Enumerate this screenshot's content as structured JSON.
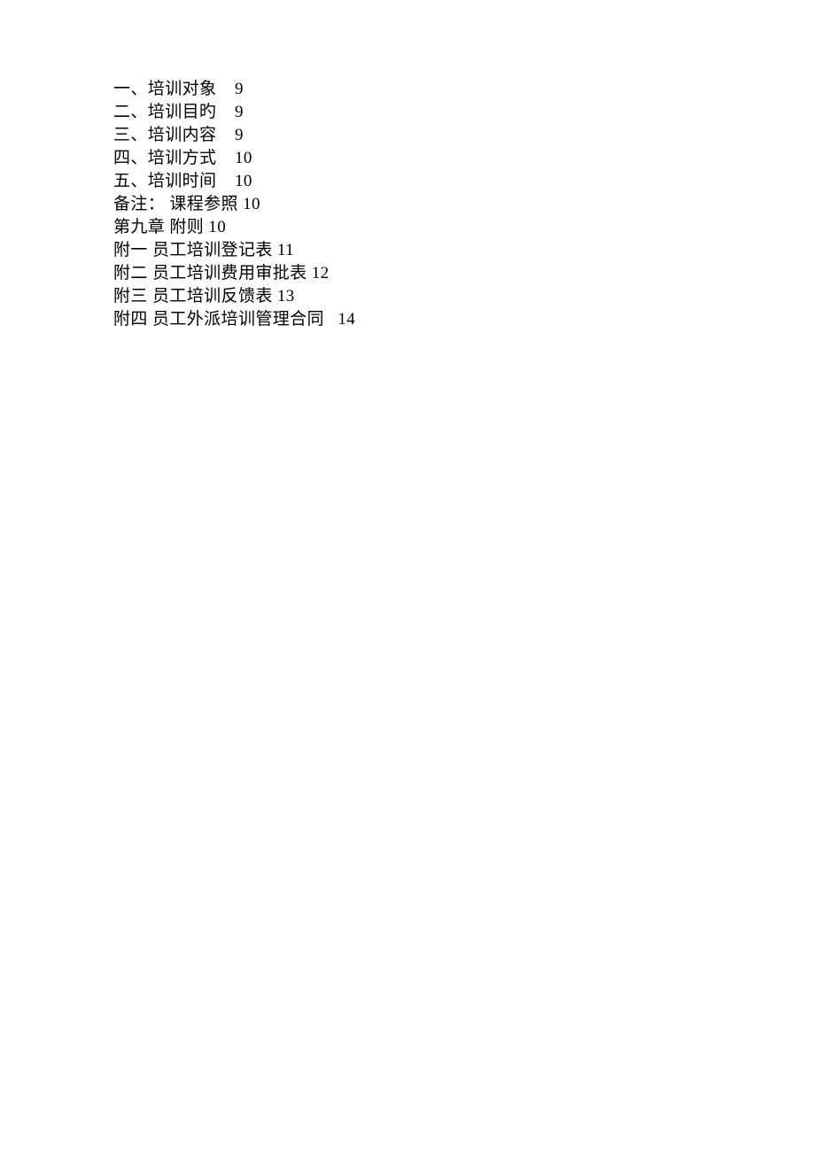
{
  "toc": {
    "lines": [
      "一、培训对象    9",
      "二、培训目旳    9",
      "三、培训内容    9",
      "四、培训方式    10",
      "五、培训时间    10",
      "备注： 课程参照 10",
      "第九章 附则 10",
      "附一 员工培训登记表 11",
      "附二 员工培训费用审批表 12",
      "附三 员工培训反馈表 13",
      "附四 员工外派培训管理合同   14"
    ]
  }
}
